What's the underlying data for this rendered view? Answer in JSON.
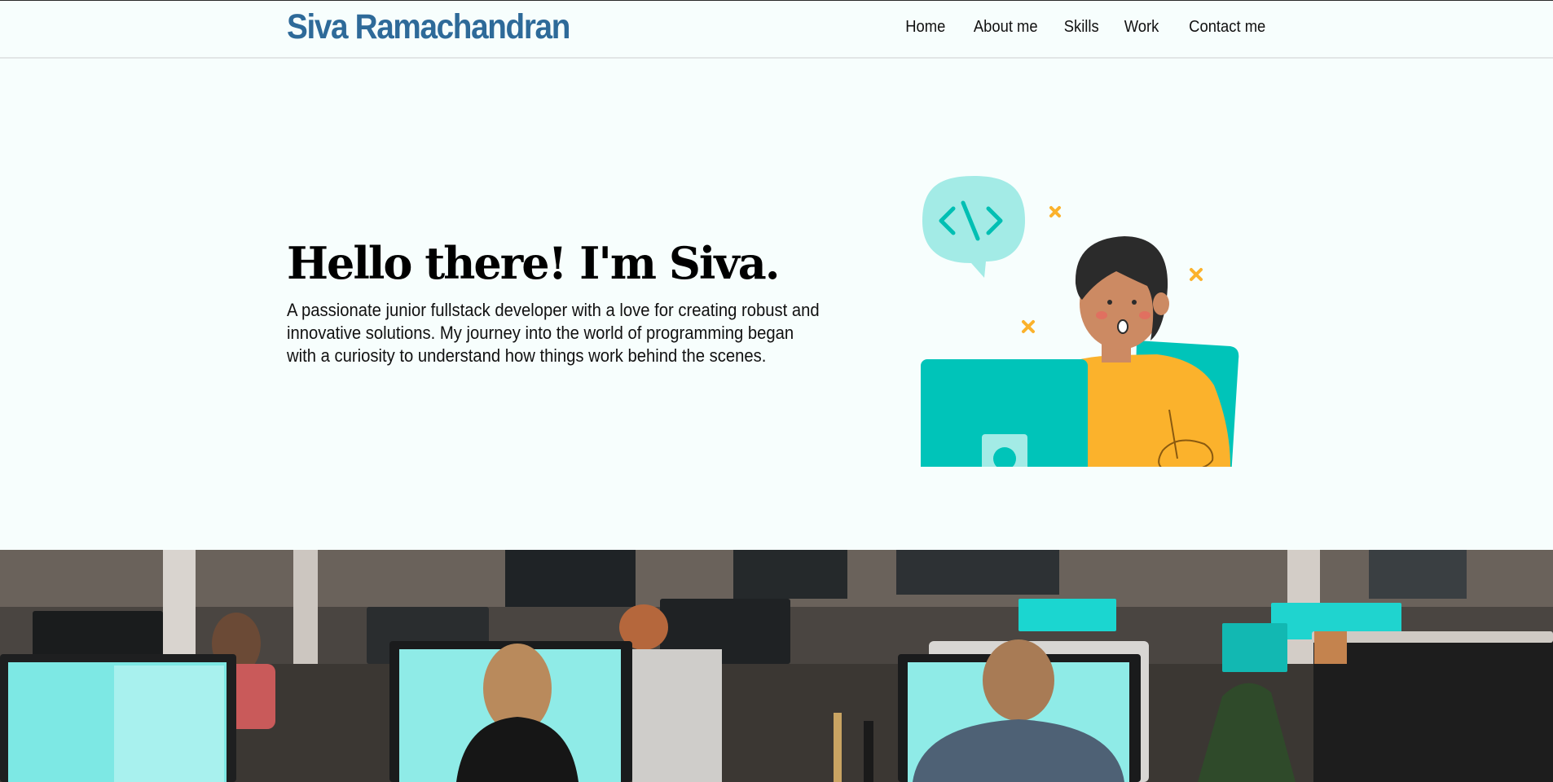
{
  "header": {
    "brand": "Siva Ramachandran",
    "nav": [
      {
        "label": "Home"
      },
      {
        "label": "About me"
      },
      {
        "label": "Skills"
      },
      {
        "label": "Work"
      },
      {
        "label": "Contact me"
      }
    ]
  },
  "hero": {
    "title": "Hello there! I'm Siva.",
    "description": "A passionate junior fullstack developer with a love for creating robust and innovative solutions. My journey into the world of programming began with a curiosity to understand how things work behind the scenes."
  },
  "colors": {
    "brand": "#2e6a99",
    "background": "#f7fefd",
    "teal": "#00c4b9",
    "light_teal": "#a3ebe6",
    "accent": "#fbb22c"
  }
}
